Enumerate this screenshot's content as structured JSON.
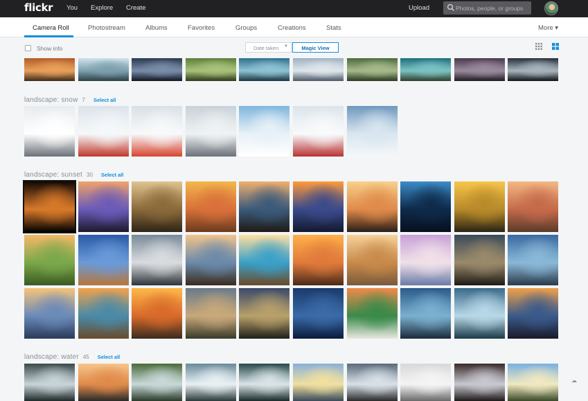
{
  "app": {
    "logo": "flickr",
    "nav": [
      "You",
      "Explore",
      "Create"
    ],
    "upload_label": "Upload",
    "search_placeholder": "Photos, people, or groups"
  },
  "tabs": [
    {
      "label": "Camera Roll",
      "active": true
    },
    {
      "label": "Photostream",
      "active": false
    },
    {
      "label": "Albums",
      "active": false
    },
    {
      "label": "Favorites",
      "active": false
    },
    {
      "label": "Groups",
      "active": false
    },
    {
      "label": "Creations",
      "active": false
    },
    {
      "label": "Stats",
      "active": false
    }
  ],
  "more_label": "More ▾",
  "toolbar": {
    "show_info_label": "Show info",
    "sort_label": "Date taken",
    "magic_view_label": "Magic View"
  },
  "sections": [
    {
      "title": "landscape: snow",
      "count": "7",
      "select_all": "Select all"
    },
    {
      "title": "landscape: sunset",
      "count": "30",
      "select_all": "Select all"
    },
    {
      "title": "landscape: water",
      "count": "45",
      "select_all": "Select all"
    }
  ],
  "colors": {
    "accent": "#128fdc",
    "topbar": "#212124",
    "background": "#f3f5f6"
  },
  "photos": {
    "top_row": [
      [
        "#b35c2a",
        "#e8a05a",
        "#3d2a1a"
      ],
      [
        "#cfe2ec",
        "#7da0ad",
        "#2d4046"
      ],
      [
        "#2b3a52",
        "#7a8da8",
        "#0f1622"
      ],
      [
        "#5e7f3a",
        "#a9c27a",
        "#2c3a1c"
      ],
      [
        "#2f6f8c",
        "#8dc3d4",
        "#1a3440"
      ],
      [
        "#9fb2c2",
        "#dfe6ec",
        "#4c5966"
      ],
      [
        "#4c6a3e",
        "#a7b98a",
        "#2a3a22"
      ],
      [
        "#1e6f7a",
        "#7cc2c4",
        "#2e3e2a"
      ],
      [
        "#4a3a4e",
        "#9a8a9e",
        "#1e1a22"
      ],
      [
        "#28303a",
        "#a8b4bd",
        "#0f1418"
      ]
    ],
    "snow": [
      [
        "#e6ebee",
        "#ffffff",
        "#6b7278"
      ],
      [
        "#dbe3ea",
        "#f5f8fa",
        "#c0392b"
      ],
      [
        "#d9e0e6",
        "#f7f9fa",
        "#d6452f"
      ],
      [
        "#c9d2d8",
        "#eef2f4",
        "#6a7178"
      ],
      [
        "#7fb6de",
        "#e8f1f7",
        "#ffffff"
      ],
      [
        "#dbe4ea",
        "#f8fafb",
        "#b83232"
      ],
      [
        "#6f98bf",
        "#d9e6f0",
        "#f4f7f9"
      ]
    ],
    "sunset": [
      [
        [
          "#120804",
          "#d8792a",
          "#000000"
        ],
        [
          "#f0a36a",
          "#6b5ab8",
          "#1a1a2e"
        ],
        [
          "#e0c48e",
          "#8a6a3a",
          "#2e2416"
        ],
        [
          "#f2b64a",
          "#d9703a",
          "#6a3a1e"
        ],
        [
          "#f0b070",
          "#3b5a7a",
          "#1e1a16"
        ],
        [
          "#ff9a3a",
          "#3a4a8a",
          "#12182e"
        ],
        [
          "#f7d08a",
          "#e08a4a",
          "#2a1e16"
        ],
        [
          "#3c8cc8",
          "#0e2a4a",
          "#06101e"
        ],
        [
          "#f6c64a",
          "#b88a2a",
          "#2a2414"
        ],
        [
          "#f3b884",
          "#c56a4a",
          "#5a3a2a"
        ]
      ],
      [
        [
          "#f6b86a",
          "#7aa84a",
          "#3a5a22"
        ],
        [
          "#2a5aa8",
          "#6a9ad8",
          "#b8763a"
        ],
        [
          "#7a8a9a",
          "#d8dcdf",
          "#2e343a"
        ],
        [
          "#f3c48a",
          "#6a8aaa",
          "#3a2a1e"
        ],
        [
          "#ffe0a0",
          "#3aa0c8",
          "#6a4a2a"
        ],
        [
          "#ffb04a",
          "#e07a3a",
          "#4a2a1a"
        ],
        [
          "#f6d29a",
          "#c88a4a",
          "#7a5a3a"
        ],
        [
          "#c8a0d8",
          "#f0e0e8",
          "#6a7aa8"
        ],
        [
          "#3a4a5a",
          "#9a8a6a",
          "#1e1a16"
        ],
        [
          "#3a6aa0",
          "#8ab8d8",
          "#2a3a4a"
        ]
      ],
      [
        [
          "#f6c47a",
          "#6a8ab8",
          "#2a3a5a"
        ],
        [
          "#f2a24a",
          "#4a8aa8",
          "#6a4a2a"
        ],
        [
          "#ffb84a",
          "#d86a2a",
          "#3a2a1e"
        ],
        [
          "#6a7a8a",
          "#c8a87a",
          "#3a3a2a"
        ],
        [
          "#3a4a6a",
          "#b8a06a",
          "#1e1e1a"
        ],
        [
          "#1a3a6a",
          "#3a6aa8",
          "#0a1a3a"
        ],
        [
          "#f08a4a",
          "#3a8a4a",
          "#e8e8e0"
        ],
        [
          "#2a5a8a",
          "#7ab0d0",
          "#1a2a3a"
        ],
        [
          "#3a6a8a",
          "#b8d8e8",
          "#1a3a4a"
        ],
        [
          "#f0a04a",
          "#3a5a8a",
          "#1a1a2a"
        ]
      ]
    ],
    "water": [
      [
        "#3a4a4a",
        "#c8d4d8",
        "#1e2a2a"
      ],
      [
        "#f6c68a",
        "#e08a4a",
        "#2a2a2a"
      ],
      [
        "#4a6a3a",
        "#c8d8d8",
        "#2a3a2a"
      ],
      [
        "#6a8a9a",
        "#e8f0f4",
        "#2a3a3a"
      ],
      [
        "#2a4a4a",
        "#d8e4e8",
        "#1a2a2a"
      ],
      [
        "#8ab0d8",
        "#f0e0a0",
        "#3a4a5a"
      ],
      [
        "#5a6a7a",
        "#d8e0e8",
        "#2a2a2a"
      ],
      [
        "#d8d8d8",
        "#f4f4f4",
        "#6a6a6a"
      ],
      [
        "#3a2a2a",
        "#c8c8d0",
        "#1e1a1a"
      ],
      [
        "#7ab0e0",
        "#f0e8c0",
        "#3a4a2a"
      ]
    ]
  }
}
